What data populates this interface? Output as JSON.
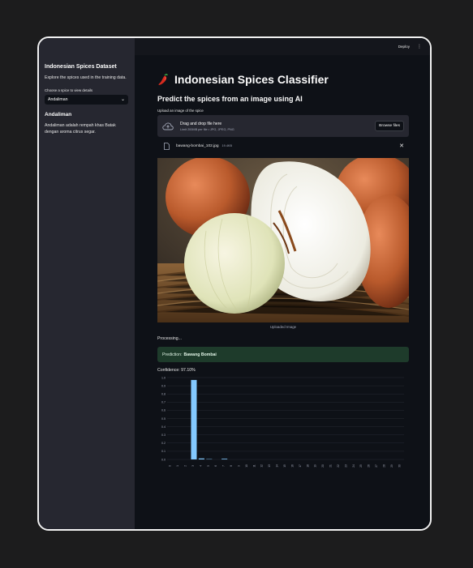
{
  "sidebar": {
    "title": "Indonesian Spices Dataset",
    "description": "Explore the spices used in the training data.",
    "select_label": "Choose a spice to view details",
    "selected_spice": "Andaliman",
    "spice_name": "Andaliman",
    "spice_description": "Andaliman adalah rempah khas Batak dengan aroma citrus segar."
  },
  "topbar": {
    "deploy_label": "Deploy",
    "menu_label": "⋮"
  },
  "main": {
    "title": "Indonesian Spices Classifier",
    "subtitle": "Predict the spices from an image using AI",
    "upload_label": "Upload an image of the spice",
    "dropzone_title": "Drag and drop file here",
    "dropzone_limits": "Limit 200MB per file • JPG, JPEG, PNG",
    "browse_label": "Browse files",
    "file_name": "bawang-bombai_102.jpg",
    "file_size": "19.4KB",
    "image_caption": "Uploaded Image",
    "processing_text": "Processing...",
    "prediction_prefix": "Prediction:",
    "prediction_value": "Bawang Bombai",
    "confidence_text": "Confidence: 97.10%"
  },
  "colors": {
    "bar": "#83c9ff",
    "prediction_bg": "#1e3b2b",
    "sidebar_bg": "#262730",
    "app_bg": "#0e1117"
  },
  "chart_data": {
    "type": "bar",
    "categories": [
      "0",
      "1",
      "2",
      "3",
      "4",
      "5",
      "6",
      "7",
      "8",
      "9",
      "10",
      "11",
      "12",
      "13",
      "14",
      "15",
      "16",
      "17",
      "18",
      "19",
      "20",
      "21",
      "22",
      "23",
      "24",
      "25",
      "26",
      "27",
      "28",
      "29",
      "30"
    ],
    "values": [
      0,
      0,
      0,
      0.971,
      0.012,
      0.004,
      0,
      0.008,
      0,
      0,
      0,
      0,
      0,
      0,
      0,
      0,
      0,
      0,
      0,
      0,
      0,
      0,
      0,
      0,
      0,
      0,
      0,
      0,
      0,
      0,
      0
    ],
    "yticks": [
      "0.0",
      "0.1",
      "0.2",
      "0.3",
      "0.4",
      "0.5",
      "0.6",
      "0.7",
      "0.8",
      "0.9",
      "1.0"
    ],
    "ylim": [
      0,
      1.0
    ]
  }
}
